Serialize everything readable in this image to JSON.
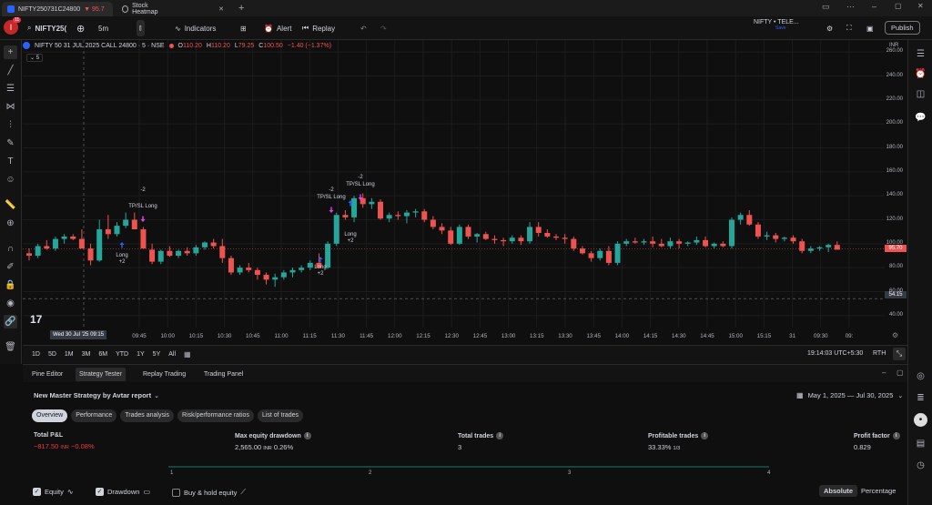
{
  "tabs": {
    "tab1": {
      "label": "NIFTY250731C24800",
      "change": "▼ 95.7"
    },
    "tab2": {
      "label": "Stock Heatmap"
    },
    "badge": "11"
  },
  "toolbar": {
    "symbol": "NIFTY25(",
    "interval": "5m",
    "indicators": "Indicators",
    "alert": "Alert",
    "replay": "Replay",
    "watch_name": "NIFTY • TELE...",
    "watch_sub": "Save",
    "publish": "Publish"
  },
  "legend": {
    "title": "NIFTY 50 31 JUL 2025 CALL 24800 · 5 · NSE",
    "o_label": "O",
    "o": "110.20",
    "h_label": "H",
    "h": "110.20",
    "l_label": "L",
    "l": "79.25",
    "c_label": "C",
    "c": "100.50",
    "chg": "−1.40 (−1.37%)",
    "collapse": "5"
  },
  "axis": {
    "currency": "INR",
    "y_ticks": [
      "260.00",
      "240.00",
      "220.00",
      "200.00",
      "180.00",
      "160.00",
      "140.00",
      "120.00",
      "100.00",
      "80.00",
      "60.00",
      "40.00"
    ],
    "price_last": "95.70",
    "price_cross": "54.15",
    "x_ticks": [
      "09:45",
      "10:00",
      "10:15",
      "10:30",
      "10:45",
      "11:00",
      "11:15",
      "11:30",
      "11:45",
      "12:00",
      "12:15",
      "12:30",
      "12:45",
      "13:00",
      "13:15",
      "13:30",
      "13:45",
      "14:00",
      "14:15",
      "14:30",
      "14:45",
      "15:00",
      "15:15",
      "31",
      "09:30",
      "09:"
    ],
    "x_cursor": "Wed 30 Jul '25",
    "x_cursor_time": "09:15"
  },
  "annotations": {
    "minus2": "-2",
    "tpsl": "TP/SL Long",
    "long": "Long",
    "plus2": "+2"
  },
  "ranges": {
    "items": [
      "1D",
      "5D",
      "1M",
      "3M",
      "6M",
      "YTD",
      "1Y",
      "5Y",
      "All"
    ],
    "clock": "19:14:03 UTC+5:30",
    "rth": "RTH"
  },
  "panel_tabs": [
    "Pine Editor",
    "Strategy Tester",
    "Replay Trading",
    "Trading Panel"
  ],
  "strategy": {
    "name": "New Master Strategy by Avtar report",
    "date_range": "May 1, 2025 — Jul 30, 2025",
    "subtabs": [
      "Overview",
      "Performance",
      "Trades analysis",
      "Risk/performance ratios",
      "List of trades"
    ]
  },
  "stats": {
    "pnl_label": "Total P&L",
    "pnl_value": "−817.50",
    "pnl_unit": "INR",
    "pnl_pct": "−0.08%",
    "dd_label": "Max equity drawdown",
    "dd_value": "2,565.00",
    "dd_unit": "INR",
    "dd_pct": "0.26%",
    "trades_label": "Total trades",
    "trades_value": "3",
    "prof_label": "Profitable trades",
    "prof_value": "33.33%",
    "prof_frac": "1/3",
    "pf_label": "Profit factor",
    "pf_value": "0.829"
  },
  "equity_axis": [
    "1",
    "2",
    "3",
    "4"
  ],
  "footer": {
    "equity": "Equity",
    "drawdown": "Drawdown",
    "buyhold": "Buy & hold equity",
    "absolute": "Absolute",
    "percentage": "Percentage"
  },
  "colors": {
    "up": "#26a69a",
    "down": "#ef5350",
    "accent": "#2962ff",
    "marker": "#e040fb"
  },
  "chart_data": {
    "type": "candlestick",
    "title": "NIFTY 50 31 JUL 2025 CALL 24800 · 5 · NSE",
    "ylim": [
      30,
      270
    ],
    "candles": [
      {
        "o": 92,
        "h": 96,
        "l": 86,
        "c": 90
      },
      {
        "o": 90,
        "h": 100,
        "l": 88,
        "c": 98
      },
      {
        "o": 98,
        "h": 103,
        "l": 95,
        "c": 96
      },
      {
        "o": 96,
        "h": 106,
        "l": 94,
        "c": 104
      },
      {
        "o": 104,
        "h": 108,
        "l": 100,
        "c": 106
      },
      {
        "o": 106,
        "h": 108,
        "l": 103,
        "c": 104
      },
      {
        "o": 104,
        "h": 112,
        "l": 100,
        "c": 96
      },
      {
        "o": 96,
        "h": 100,
        "l": 82,
        "c": 86
      },
      {
        "o": 86,
        "h": 120,
        "l": 85,
        "c": 112
      },
      {
        "o": 112,
        "h": 124,
        "l": 104,
        "c": 108
      },
      {
        "o": 108,
        "h": 118,
        "l": 106,
        "c": 115
      },
      {
        "o": 115,
        "h": 126,
        "l": 113,
        "c": 120
      },
      {
        "o": 120,
        "h": 126,
        "l": 112,
        "c": 112
      },
      {
        "o": 112,
        "h": 114,
        "l": 98,
        "c": 96
      },
      {
        "o": 95,
        "h": 100,
        "l": 83,
        "c": 85
      },
      {
        "o": 85,
        "h": 95,
        "l": 83,
        "c": 94
      },
      {
        "o": 94,
        "h": 98,
        "l": 89,
        "c": 90
      },
      {
        "o": 90,
        "h": 95,
        "l": 88,
        "c": 94
      },
      {
        "o": 94,
        "h": 97,
        "l": 90,
        "c": 92
      },
      {
        "o": 92,
        "h": 99,
        "l": 90,
        "c": 97
      },
      {
        "o": 97,
        "h": 102,
        "l": 95,
        "c": 101
      },
      {
        "o": 101,
        "h": 104,
        "l": 96,
        "c": 98
      },
      {
        "o": 98,
        "h": 104,
        "l": 84,
        "c": 88
      },
      {
        "o": 88,
        "h": 90,
        "l": 74,
        "c": 76
      },
      {
        "o": 76,
        "h": 82,
        "l": 74,
        "c": 80
      },
      {
        "o": 80,
        "h": 84,
        "l": 76,
        "c": 78
      },
      {
        "o": 78,
        "h": 80,
        "l": 70,
        "c": 74
      },
      {
        "o": 74,
        "h": 76,
        "l": 66,
        "c": 70
      },
      {
        "o": 70,
        "h": 75,
        "l": 64,
        "c": 72
      },
      {
        "o": 72,
        "h": 78,
        "l": 70,
        "c": 76
      },
      {
        "o": 76,
        "h": 80,
        "l": 72,
        "c": 78
      },
      {
        "o": 78,
        "h": 82,
        "l": 76,
        "c": 80
      },
      {
        "o": 80,
        "h": 86,
        "l": 78,
        "c": 84
      },
      {
        "o": 84,
        "h": 92,
        "l": 80,
        "c": 80
      },
      {
        "o": 80,
        "h": 102,
        "l": 79,
        "c": 100
      },
      {
        "o": 100,
        "h": 126,
        "l": 98,
        "c": 124
      },
      {
        "o": 124,
        "h": 128,
        "l": 120,
        "c": 122
      },
      {
        "o": 122,
        "h": 140,
        "l": 118,
        "c": 138
      },
      {
        "o": 138,
        "h": 142,
        "l": 130,
        "c": 133
      },
      {
        "o": 133,
        "h": 138,
        "l": 129,
        "c": 135
      },
      {
        "o": 135,
        "h": 137,
        "l": 120,
        "c": 121
      },
      {
        "o": 121,
        "h": 126,
        "l": 118,
        "c": 124
      },
      {
        "o": 124,
        "h": 127,
        "l": 120,
        "c": 123
      },
      {
        "o": 123,
        "h": 128,
        "l": 117,
        "c": 126
      },
      {
        "o": 126,
        "h": 129,
        "l": 122,
        "c": 127
      },
      {
        "o": 127,
        "h": 129,
        "l": 118,
        "c": 120
      },
      {
        "o": 120,
        "h": 123,
        "l": 112,
        "c": 114
      },
      {
        "o": 114,
        "h": 117,
        "l": 108,
        "c": 111
      },
      {
        "o": 111,
        "h": 114,
        "l": 99,
        "c": 100
      },
      {
        "o": 100,
        "h": 116,
        "l": 99,
        "c": 114
      },
      {
        "o": 114,
        "h": 116,
        "l": 104,
        "c": 106
      },
      {
        "o": 106,
        "h": 109,
        "l": 101,
        "c": 108
      },
      {
        "o": 108,
        "h": 110,
        "l": 103,
        "c": 104
      },
      {
        "o": 104,
        "h": 107,
        "l": 100,
        "c": 103
      },
      {
        "o": 103,
        "h": 105,
        "l": 98,
        "c": 102
      },
      {
        "o": 102,
        "h": 107,
        "l": 100,
        "c": 105
      },
      {
        "o": 105,
        "h": 107,
        "l": 99,
        "c": 102
      },
      {
        "o": 102,
        "h": 118,
        "l": 100,
        "c": 114
      },
      {
        "o": 114,
        "h": 118,
        "l": 106,
        "c": 109
      },
      {
        "o": 109,
        "h": 112,
        "l": 105,
        "c": 106
      },
      {
        "o": 106,
        "h": 108,
        "l": 103,
        "c": 105
      },
      {
        "o": 105,
        "h": 108,
        "l": 100,
        "c": 104
      },
      {
        "o": 104,
        "h": 106,
        "l": 94,
        "c": 96
      },
      {
        "o": 96,
        "h": 98,
        "l": 91,
        "c": 92
      },
      {
        "o": 92,
        "h": 94,
        "l": 85,
        "c": 88
      },
      {
        "o": 88,
        "h": 96,
        "l": 86,
        "c": 94
      },
      {
        "o": 94,
        "h": 98,
        "l": 82,
        "c": 84
      },
      {
        "o": 84,
        "h": 102,
        "l": 82,
        "c": 100
      },
      {
        "o": 100,
        "h": 104,
        "l": 98,
        "c": 102
      },
      {
        "o": 102,
        "h": 105,
        "l": 100,
        "c": 101
      },
      {
        "o": 101,
        "h": 104,
        "l": 99,
        "c": 102
      },
      {
        "o": 102,
        "h": 106,
        "l": 97,
        "c": 100
      },
      {
        "o": 100,
        "h": 104,
        "l": 97,
        "c": 98
      },
      {
        "o": 98,
        "h": 105,
        "l": 96,
        "c": 102
      },
      {
        "o": 102,
        "h": 104,
        "l": 96,
        "c": 100
      },
      {
        "o": 100,
        "h": 102,
        "l": 98,
        "c": 101
      },
      {
        "o": 101,
        "h": 106,
        "l": 99,
        "c": 103
      },
      {
        "o": 103,
        "h": 106,
        "l": 97,
        "c": 98
      },
      {
        "o": 98,
        "h": 101,
        "l": 96,
        "c": 100
      },
      {
        "o": 100,
        "h": 102,
        "l": 97,
        "c": 98
      },
      {
        "o": 98,
        "h": 122,
        "l": 96,
        "c": 120
      },
      {
        "o": 120,
        "h": 126,
        "l": 116,
        "c": 124
      },
      {
        "o": 124,
        "h": 128,
        "l": 115,
        "c": 116
      },
      {
        "o": 116,
        "h": 118,
        "l": 104,
        "c": 106
      },
      {
        "o": 106,
        "h": 110,
        "l": 103,
        "c": 107
      },
      {
        "o": 107,
        "h": 109,
        "l": 101,
        "c": 104
      },
      {
        "o": 104,
        "h": 106,
        "l": 102,
        "c": 105
      },
      {
        "o": 105,
        "h": 107,
        "l": 100,
        "c": 102
      },
      {
        "o": 102,
        "h": 104,
        "l": 92,
        "c": 94
      },
      {
        "o": 94,
        "h": 98,
        "l": 92,
        "c": 96
      },
      {
        "o": 96,
        "h": 98,
        "l": 94,
        "c": 97
      },
      {
        "o": 97,
        "h": 100,
        "l": 93,
        "c": 99
      },
      {
        "o": 99,
        "h": 102,
        "l": 96,
        "c": 95
      }
    ]
  }
}
